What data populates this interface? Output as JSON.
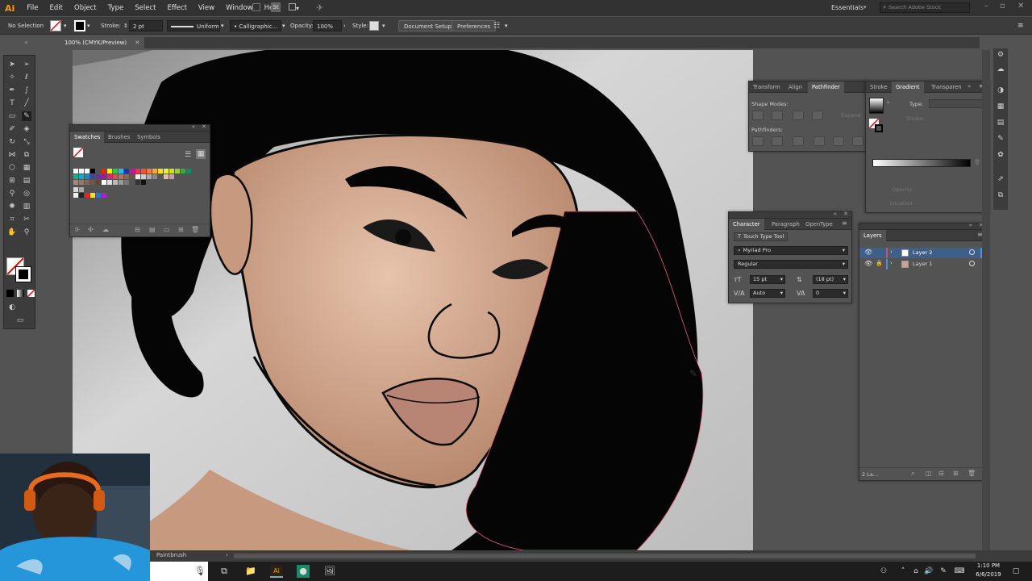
{
  "app": {
    "logo": "Ai",
    "workspace": "Essentials",
    "stock_placeholder": "Search Adobe Stock"
  },
  "menu": [
    "File",
    "Edit",
    "Object",
    "Type",
    "Select",
    "Effect",
    "View",
    "Window",
    "Help"
  ],
  "control_bar": {
    "selection": "No Selection",
    "stroke_label": "Stroke:",
    "stroke_value": "2 pt",
    "profile": "Uniform",
    "brush": "Calligraphic...",
    "opacity_label": "Opacity:",
    "opacity_value": "100%",
    "style_label": "Style:",
    "doc_setup": "Document Setup",
    "preferences": "Preferences"
  },
  "document_tab": "100% (CMYK/Preview)",
  "swatches_panel": {
    "tabs": [
      "Swatches",
      "Brushes",
      "Symbols"
    ]
  },
  "pathfinder_panel": {
    "tabs": [
      "Transform",
      "Align",
      "Pathfinder"
    ],
    "shape_modes": "Shape Modes:",
    "expand": "Expand",
    "pathfinders": "Pathfinders:"
  },
  "gradient_panel": {
    "tabs": [
      "Stroke",
      "Gradient",
      "Transparen"
    ],
    "type_label": "Type:",
    "stroke_label": "Stroke:",
    "opacity_label": "Opacity:",
    "location_label": "Location:"
  },
  "character_panel": {
    "tabs": [
      "Character",
      "Paragraph",
      "OpenType"
    ],
    "touch_type": "Touch Type Tool",
    "font": "Myriad Pro",
    "style": "Regular",
    "size": "15 pt",
    "leading": "(18 pt)",
    "kerning": "Auto",
    "tracking": "0"
  },
  "layers_panel": {
    "title": "Layers",
    "layers": [
      "Layer 2",
      "Layer 1"
    ],
    "footer": "2 La..."
  },
  "status": {
    "tool": "Paintbrush"
  },
  "clock": {
    "time": "1:10 PM",
    "date": "6/6/2019"
  },
  "colors": {
    "ui_dark": "#323232",
    "panel": "#535353",
    "accent": "#ff9a00",
    "layer2": "#4a90e2",
    "layer1": "#e84a4a",
    "skin": "#d3a68c",
    "hair": "#050505"
  }
}
